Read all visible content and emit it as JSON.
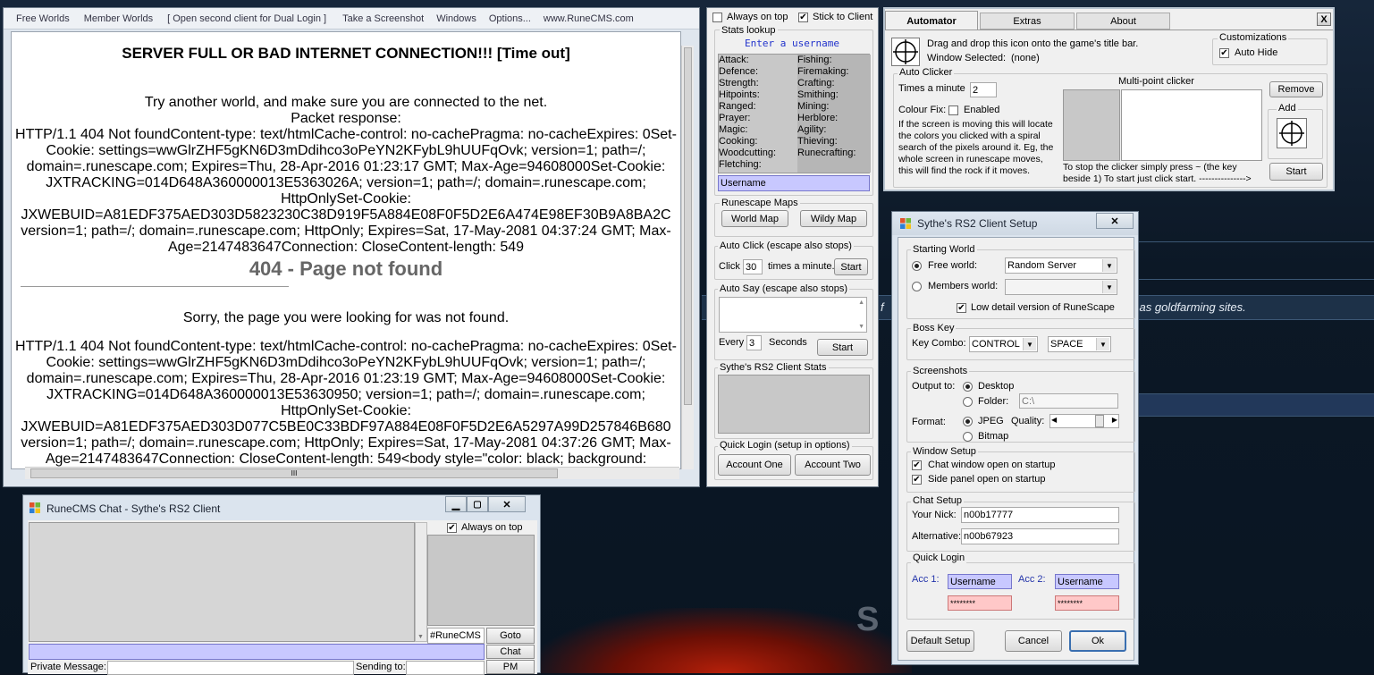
{
  "browser": {
    "menu": [
      "Free Worlds",
      "Member Worlds",
      "[ Open second client for Dual Login ]",
      "Take a Screenshot",
      "Windows",
      "Options...",
      "www.RuneCMS.com"
    ],
    "heading": "SERVER FULL OR BAD INTERNET CONNECTION!!! [Time out]",
    "paragraphs": [
      "Try another world, and make sure you are connected to the net.",
      "Packet response:",
      "HTTP/1.1 404 Not foundContent-type: text/htmlCache-control: no-cachePragma: no-cacheExpires: 0Set-",
      "Cookie: settings=wwGlrZHF5gKN6D3mDdihco3oPeYN2KFybL9hUUFqOvk; version=1; path=/;",
      "domain=.runescape.com; Expires=Thu, 28-Apr-2016 01:23:17 GMT; Max-Age=94608000Set-Cookie:",
      "JXTRACKING=014D648A360000013E5363026A; version=1; path=/; domain=.runescape.com;",
      "HttpOnlySet-Cookie:",
      "JXWEBUID=A81EDF375AED303D5823230C38D919F5A884E08F0F5D2E6A474E98EF30B9A8BA2C",
      "version=1; path=/; domain=.runescape.com; HttpOnly; Expires=Sat, 17-May-2081 04:37:24 GMT; Max-",
      "Age=2147483647Connection: CloseContent-length: 549"
    ],
    "notfound": "404 - Page not found",
    "sorry": "Sorry, the page you were looking for was not found.",
    "paragraphs2": [
      "HTTP/1.1 404 Not foundContent-type: text/htmlCache-control: no-cachePragma: no-cacheExpires: 0Set-",
      "Cookie: settings=wwGlrZHF5gKN6D3mDdihco3oPeYN2KFybL9hUUFqOvk; version=1; path=/;",
      "domain=.runescape.com; Expires=Thu, 28-Apr-2016 01:23:19 GMT; Max-Age=94608000Set-Cookie:",
      "JXTRACKING=014D648A360000013E53630950; version=1; path=/; domain=.runescape.com;",
      "HttpOnlySet-Cookie:",
      "JXWEBUID=A81EDF375AED303D077C5BE0C33BDF97A884E08F0F5D2E6A5297A99D257846B680",
      "version=1; path=/; domain=.runescape.com; HttpOnly; Expires=Sat, 17-May-2081 04:37:26 GMT; Max-",
      "Age=2147483647Connection: CloseContent-length: 549<body style=\"color: black; background:"
    ],
    "scroll_grip": "III"
  },
  "panel": {
    "always_on_top": "Always on top",
    "stick_to_client": "Stick to Client",
    "stats_lookup": "Stats lookup",
    "enter_username": "Enter a username",
    "skills_left": [
      "Attack:",
      "Defence:",
      "Strength:",
      "Hitpoints:",
      "Ranged:",
      "Prayer:",
      "Magic:",
      "Cooking:",
      "Woodcutting:",
      "Fletching:"
    ],
    "skills_right": [
      "Fishing:",
      "Firemaking:",
      "Crafting:",
      "Smithing:",
      "Mining:",
      "Herblore:",
      "Agility:",
      "Thieving:",
      "Runecrafting:"
    ],
    "username": "Username",
    "maps_title": "Runescape Maps",
    "world_map": "World Map",
    "wildy_map": "Wildy Map",
    "autoclick_title": "Auto Click (escape also stops)",
    "click": "Click",
    "click_value": "30",
    "times_minute": "times a minute.",
    "start": "Start",
    "autosay_title": "Auto Say (escape also stops)",
    "every": "Every",
    "every_value": "3",
    "seconds": "Seconds",
    "stats_title": "Sythe's RS2 Client Stats",
    "quicklogin_title": "Quick Login (setup in options)",
    "account_one": "Account One",
    "account_two": "Account Two"
  },
  "automator": {
    "tabs": [
      "Automator",
      "Extras",
      "About"
    ],
    "close": "X",
    "drag_text": "Drag and drop this icon onto the game's title bar.",
    "window_selected": "Window Selected:",
    "window_selected_value": "(none)",
    "customizations": "Customizations",
    "auto_hide": "Auto Hide",
    "auto_clicker": "Auto Clicker",
    "times_a_minute": "Times a minute",
    "times_value": "2",
    "colour_fix": "Colour Fix:",
    "enabled": "Enabled",
    "colour_desc": [
      "If the screen is moving this will locate",
      "the colors you clicked with a spiral",
      "search of the pixels around it. Eg, the",
      "whole screen in runescape moves,",
      "this will find the rock if it moves."
    ],
    "multipoint": "Multi-point clicker",
    "remove": "Remove",
    "add": "Add",
    "stop_text": [
      "To stop the clicker simply press ~ (the key",
      "beside 1) To start just click start. --------------->"
    ],
    "start": "Start"
  },
  "setup": {
    "title": "Sythe's RS2 Client Setup",
    "close": "✕",
    "starting_world": "Starting World",
    "free_world": "Free world:",
    "free_world_value": "Random Server",
    "members_world": "Members world:",
    "low_detail": "Low detail version of RuneScape",
    "boss_key": "Boss Key",
    "key_combo": "Key Combo:",
    "key1": "CONTROL",
    "key2": "SPACE",
    "screenshots": "Screenshots",
    "output_to": "Output to:",
    "desktop": "Desktop",
    "folder": "Folder:",
    "folder_value": "C:\\",
    "format": "Format:",
    "jpeg": "JPEG",
    "quality": "Quality:",
    "bitmap": "Bitmap",
    "window_setup": "Window Setup",
    "chat_open": "Chat window open on startup",
    "side_open": "Side panel open on startup",
    "chat_setup": "Chat Setup",
    "your_nick": "Your Nick:",
    "nick_value": "n00b17777",
    "alternative": "Alternative:",
    "alt_value": "n00b67923",
    "quick_login": "Quick Login",
    "acc1": "Acc 1:",
    "acc2": "Acc 2:",
    "username": "Username",
    "password": "********",
    "default_setup": "Default Setup",
    "cancel": "Cancel",
    "ok": "Ok"
  },
  "chat": {
    "title": "RuneCMS Chat - Sythe's RS2 Client",
    "always_on_top": "Always on top",
    "channel": "#RuneCMS",
    "goto": "Goto",
    "chat": "Chat",
    "pm": "PM",
    "private_message": "Private Message:",
    "sending_to": "Sending to:"
  },
  "desktop": {
    "partial_f": "f",
    "gold_text": "l as goldfarming sites.",
    "logo_s": "S"
  }
}
